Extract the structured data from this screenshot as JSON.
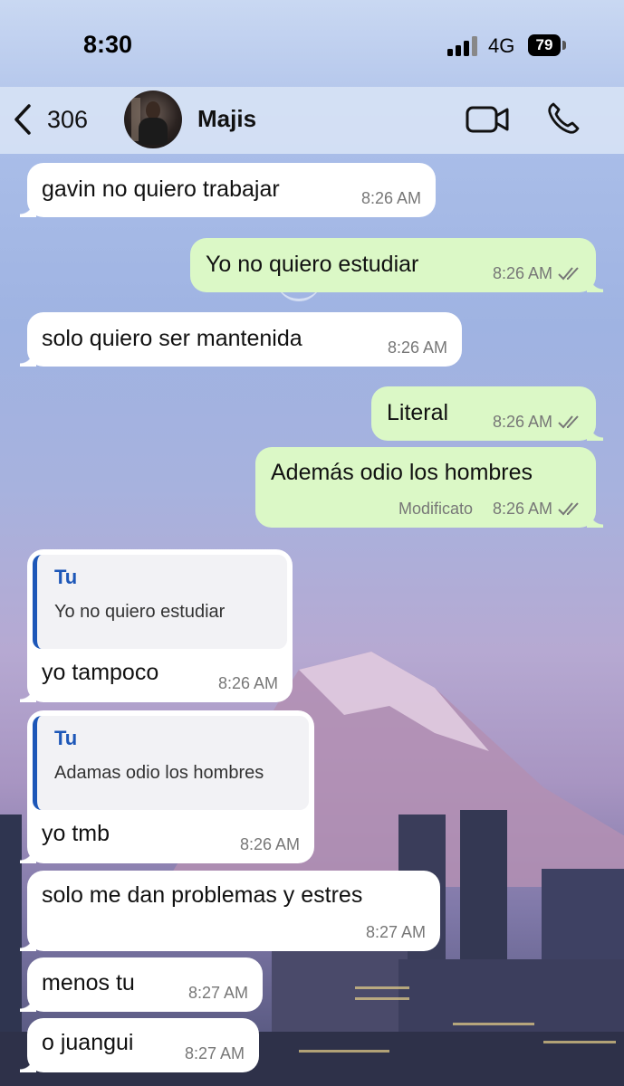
{
  "status_bar": {
    "time": "8:30",
    "network": "4G",
    "battery": "79"
  },
  "header": {
    "back_count": "306",
    "contact_name": "Majis"
  },
  "messages": [
    {
      "direction": "in",
      "text": "gavin no quiero trabajar",
      "time": "8:26 AM"
    },
    {
      "direction": "out",
      "text": "Yo no quiero estudiar",
      "time": "8:26 AM",
      "read": true
    },
    {
      "direction": "in",
      "text": "solo quiero ser mantenida",
      "time": "8:26 AM"
    },
    {
      "direction": "out",
      "text": "Literal",
      "time": "8:26 AM",
      "read": true
    },
    {
      "direction": "out",
      "text": "Además odio los hombres",
      "edited_label": "Modificato",
      "time": "8:26 AM",
      "read": true
    },
    {
      "direction": "in",
      "reply": {
        "author": "Tu",
        "text": "Yo no quiero estudiar"
      },
      "text": "yo tampoco",
      "time": "8:26 AM"
    },
    {
      "direction": "in",
      "reply": {
        "author": "Tu",
        "text": "Adamas odio los hombres"
      },
      "text": "yo tmb",
      "time": "8:26 AM"
    },
    {
      "direction": "in",
      "text": "solo me dan problemas y estres",
      "time": "8:27 AM"
    },
    {
      "direction": "in",
      "text": "menos tu",
      "time": "8:27 AM"
    },
    {
      "direction": "in",
      "text": "o juangui",
      "time": "8:27 AM"
    }
  ],
  "colors": {
    "incoming_bubble": "#ffffff",
    "outgoing_bubble": "#dbf8c6",
    "quote_accent": "#1d57b8",
    "header_bg": "#d6e2f4"
  },
  "icons": [
    "chevron-left-icon",
    "video-camera-icon",
    "phone-icon",
    "double-check-icon",
    "signal-bars-icon",
    "battery-icon"
  ]
}
